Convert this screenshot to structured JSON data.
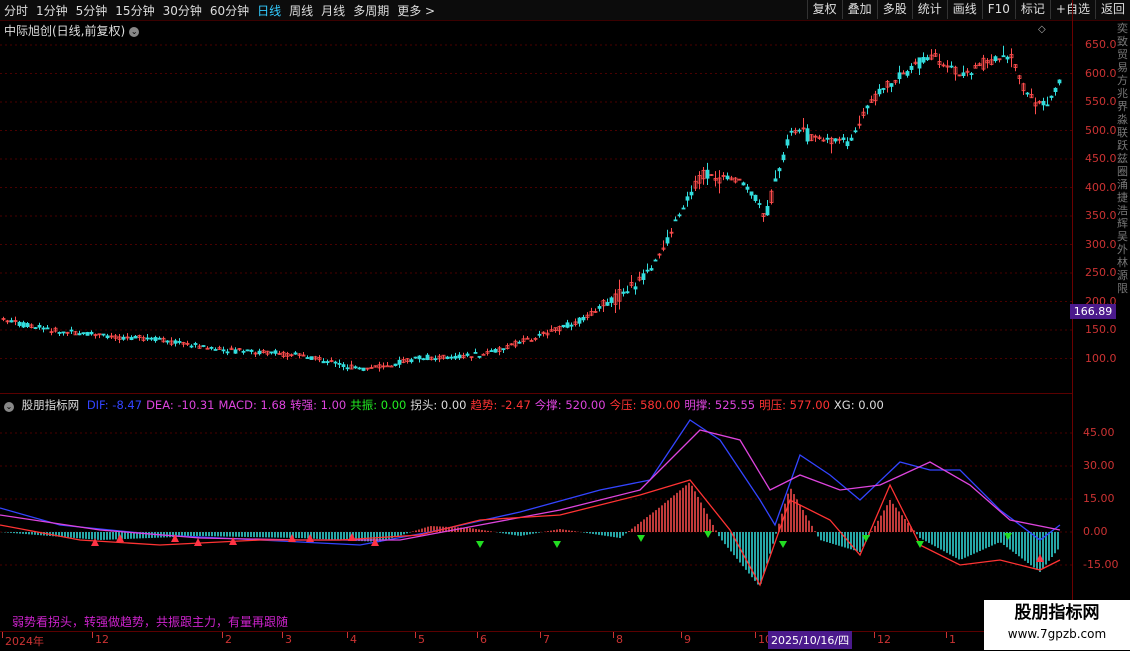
{
  "toolbar": {
    "periods": [
      "分时",
      "1分钟",
      "5分钟",
      "15分钟",
      "30分钟",
      "60分钟",
      "日线",
      "周线",
      "月线",
      "多周期",
      "更多 >"
    ],
    "active_period": "日线",
    "actions": [
      "复权",
      "叠加",
      "多股",
      "统计",
      "画线",
      "F10",
      "标记",
      "+自选",
      "返回"
    ]
  },
  "stock": {
    "title": "中际旭创(日线,前复权)",
    "current_price": "166.89"
  },
  "price_axis": [
    "650.0",
    "600.0",
    "550.0",
    "500.0",
    "450.0",
    "400.0",
    "350.0",
    "300.0",
    "250.0",
    "200.0",
    "150.0",
    "100.0"
  ],
  "indicator": {
    "name": "股朋指标网",
    "items": [
      {
        "label": "DIF: -8.47",
        "color": "#3344ff"
      },
      {
        "label": "DEA: -10.31",
        "color": "#dd44dd"
      },
      {
        "label": "MACD: 1.68",
        "color": "#dd44dd"
      },
      {
        "label": "转强: 1.00",
        "color": "#dd44dd"
      },
      {
        "label": "共振: 0.00",
        "color": "#22ee22"
      },
      {
        "label": "拐头: 0.00",
        "color": "#dddddd"
      },
      {
        "label": "趋势: -2.47",
        "color": "#ff3333"
      },
      {
        "label": "今撑: 520.00",
        "color": "#dd44dd"
      },
      {
        "label": "今压: 580.00",
        "color": "#ff3333"
      },
      {
        "label": "明撑: 525.55",
        "color": "#dd44dd"
      },
      {
        "label": "明压: 577.00",
        "color": "#ff3333"
      },
      {
        "label": "XG: 0.00",
        "color": "#dddddd"
      }
    ],
    "axis": [
      "45.00",
      "30.00",
      "15.00",
      "0.00",
      "-15.00"
    ],
    "slogan": "弱势看拐头，转强做趋势，共振跟主力，有量再跟随"
  },
  "xaxis": {
    "labels": [
      "2024年",
      "12",
      "2",
      "3",
      "4",
      "5",
      "6",
      "7",
      "8",
      "9",
      "10",
      "12",
      "1"
    ],
    "cursor_date": "2025/10/16/四"
  },
  "watermark": {
    "name": "股朋指标网",
    "url": "www.7gpzb.com"
  },
  "side_text": "奕致贸易方兆界淼联跃兹圈涌捷浩辉吴外林源限",
  "colors": {
    "up": "#ff4d4d",
    "down": "#33dddd",
    "grid": "#5a0000",
    "accent": "#4b1a8c"
  }
}
